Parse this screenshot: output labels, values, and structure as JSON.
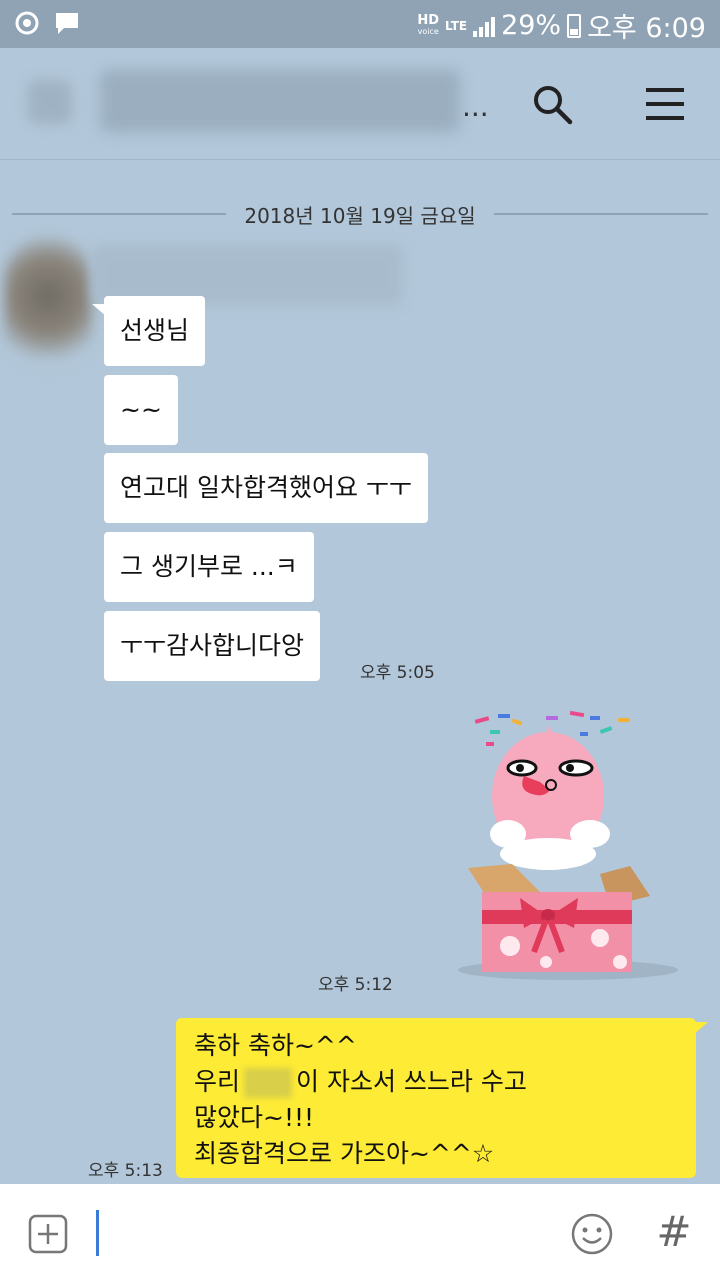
{
  "status_bar": {
    "hd_label": "HD",
    "voice_label": "voice",
    "network": "LTE",
    "battery_percent": "29%",
    "time": "오후 6:09"
  },
  "header": {
    "title_ellipsis": "..."
  },
  "chat": {
    "date_divider": "2018년 10월 19일 금요일",
    "incoming": [
      {
        "text": "선생님"
      },
      {
        "text": "~~"
      },
      {
        "text": "연고대 일차합격했어요 ㅜㅜ"
      },
      {
        "text": "그 생기부로 ...ㅋ"
      },
      {
        "text": "ㅜㅜ감사합니다앙"
      }
    ],
    "incoming_time": "오후 5:05",
    "sticker_time": "오후 5:12",
    "outgoing": {
      "line1": "축하 축하~^^",
      "line2_prefix": "우리",
      "line2_suffix": "이 자소서 쓰느라 수고",
      "line3": "많았다~!!!",
      "line4": "최종합격으로 가즈아~^^☆",
      "time": "오후 5:13"
    }
  },
  "input": {
    "hash_label": "#"
  },
  "colors": {
    "background": "#b2c7d9",
    "outgoing_bubble": "#fdeb35",
    "incoming_bubble": "#ffffff",
    "status_bar": "#8fa3b5"
  }
}
